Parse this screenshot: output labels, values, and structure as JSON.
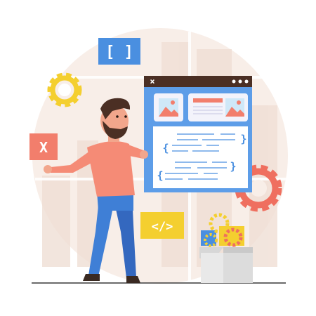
{
  "illustration": {
    "brackets_tag": "[ ]",
    "close_tag": "X",
    "code_tag": "</>",
    "window_close": "×",
    "brace_open": "{",
    "brace_close": "}"
  },
  "colors": {
    "background_circle": "#f8eee8",
    "window_bar": "#4b2f24",
    "window_body": "#5d9de8",
    "accent_salmon": "#f27e6c",
    "accent_blue": "#4a8fe0",
    "accent_yellow": "#f4cf2f",
    "gear_red": "#ef6f5f",
    "shirt": "#f58b76",
    "pants": "#3f7fd6"
  }
}
